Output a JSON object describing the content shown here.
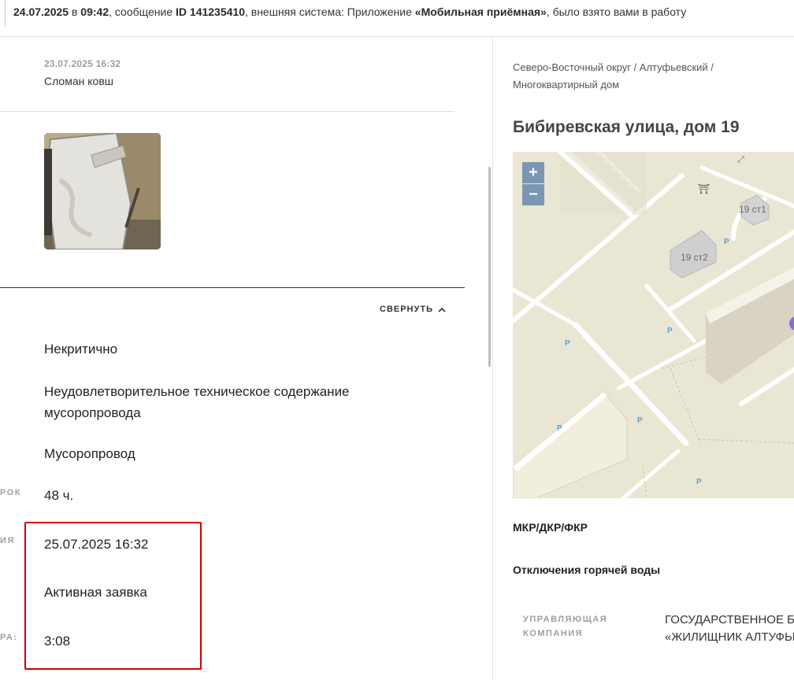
{
  "notice": {
    "date": "24.07.2025",
    "in_word": " в ",
    "time": "09:42",
    "text_message": ", сообщение ",
    "id_label": "ID 141235410",
    "text_external": ", внешняя система: Приложение ",
    "system_name": "«Мобильная приёмная»",
    "text_tail": ", было взято вами в работу"
  },
  "message": {
    "date": "23.07.2025 16:32",
    "text": "Сломан ковш"
  },
  "details": {
    "collapse_label": "СВЕРНУТЬ",
    "criticality": "Некритично",
    "problem": "Неудовлетворительное техническое содержание мусоропровода",
    "category": "Мусоропровод",
    "deadline_label_fragment": "РОК",
    "deadline": "48 ч.",
    "due_label_fragment": "ИЯ",
    "due_date": "25.07.2025 16:32",
    "status": "Активная заявка",
    "timer_label_fragment": "РА:",
    "timer": "3:08"
  },
  "location": {
    "breadcrumb": "Северо-Восточный округ / Алтуфьевский / Многоквартирный дом",
    "address": "Бибиревская улица, дом 19",
    "map": {
      "zoom_in": "+",
      "zoom_out": "−",
      "building_1": "19 ст1",
      "building_2": "19 ст2",
      "parking": "P"
    },
    "repairs_title": "МКР/ДКР/ФКР",
    "hot_water_title": "Отключения горячей воды",
    "management_label": "УПРАВЛЯЮЩАЯ КОМПАНИЯ",
    "management_value_line1": "ГОСУДАРСТВЕННОЕ БЮ",
    "management_value_line2": "«ЖИЛИЩНИК АЛТУФЬЕ"
  },
  "colors": {
    "highlight_border": "#d00000",
    "map_background": "#e9e6d4",
    "map_zoom_button": "#7b96b3",
    "map_marker": "#8a6fd6"
  }
}
